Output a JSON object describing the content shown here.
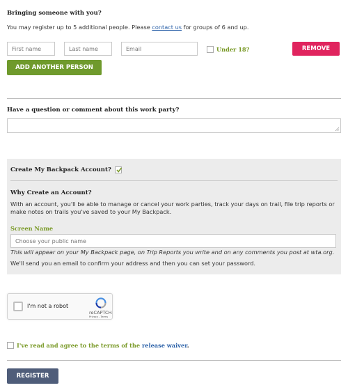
{
  "guests": {
    "heading": "Bringing someone with you?",
    "intro_prefix": "You may register up to 5 additional people. Please ",
    "contact_link": "contact us",
    "intro_suffix": " for groups of 6 and up.",
    "first_name_placeholder": "First name",
    "last_name_placeholder": "Last name",
    "email_placeholder": "Email",
    "under18_label": "Under 18?",
    "remove_label": "REMOVE",
    "add_label": "ADD ANOTHER PERSON"
  },
  "question": {
    "heading": "Have a question or comment about this work party?",
    "value": ""
  },
  "account": {
    "create_label": "Create My Backpack Account?",
    "create_checked": true,
    "why_heading": "Why Create an Account?",
    "why_text": "With an account, you'll be able to manage or cancel your work parties, track your days on trail, file trip reports or make notes on trails you've saved to your My Backpack.",
    "screen_name_label": "Screen Name",
    "screen_name_placeholder": "Choose your public name",
    "screen_name_note": "This will appear on your My Backpack page, on Trip Reports you write and on any comments you post at wta.org.",
    "email_note": "We'll send you an email to confirm your address and then you can set your password."
  },
  "captcha": {
    "label": "I'm not a robot",
    "brand": "reCAPTCHA",
    "links": "Privacy - Terms"
  },
  "waiver": {
    "text_prefix": "I've read and agree to the terms of the ",
    "link": "release waiver",
    "text_suffix": "."
  },
  "register_label": "REGISTER",
  "colors": {
    "remove": "#e0245e",
    "add": "#6f9a2c",
    "register": "#4f5d7a",
    "green_text": "#7a9a28",
    "link": "#2b61a8"
  }
}
